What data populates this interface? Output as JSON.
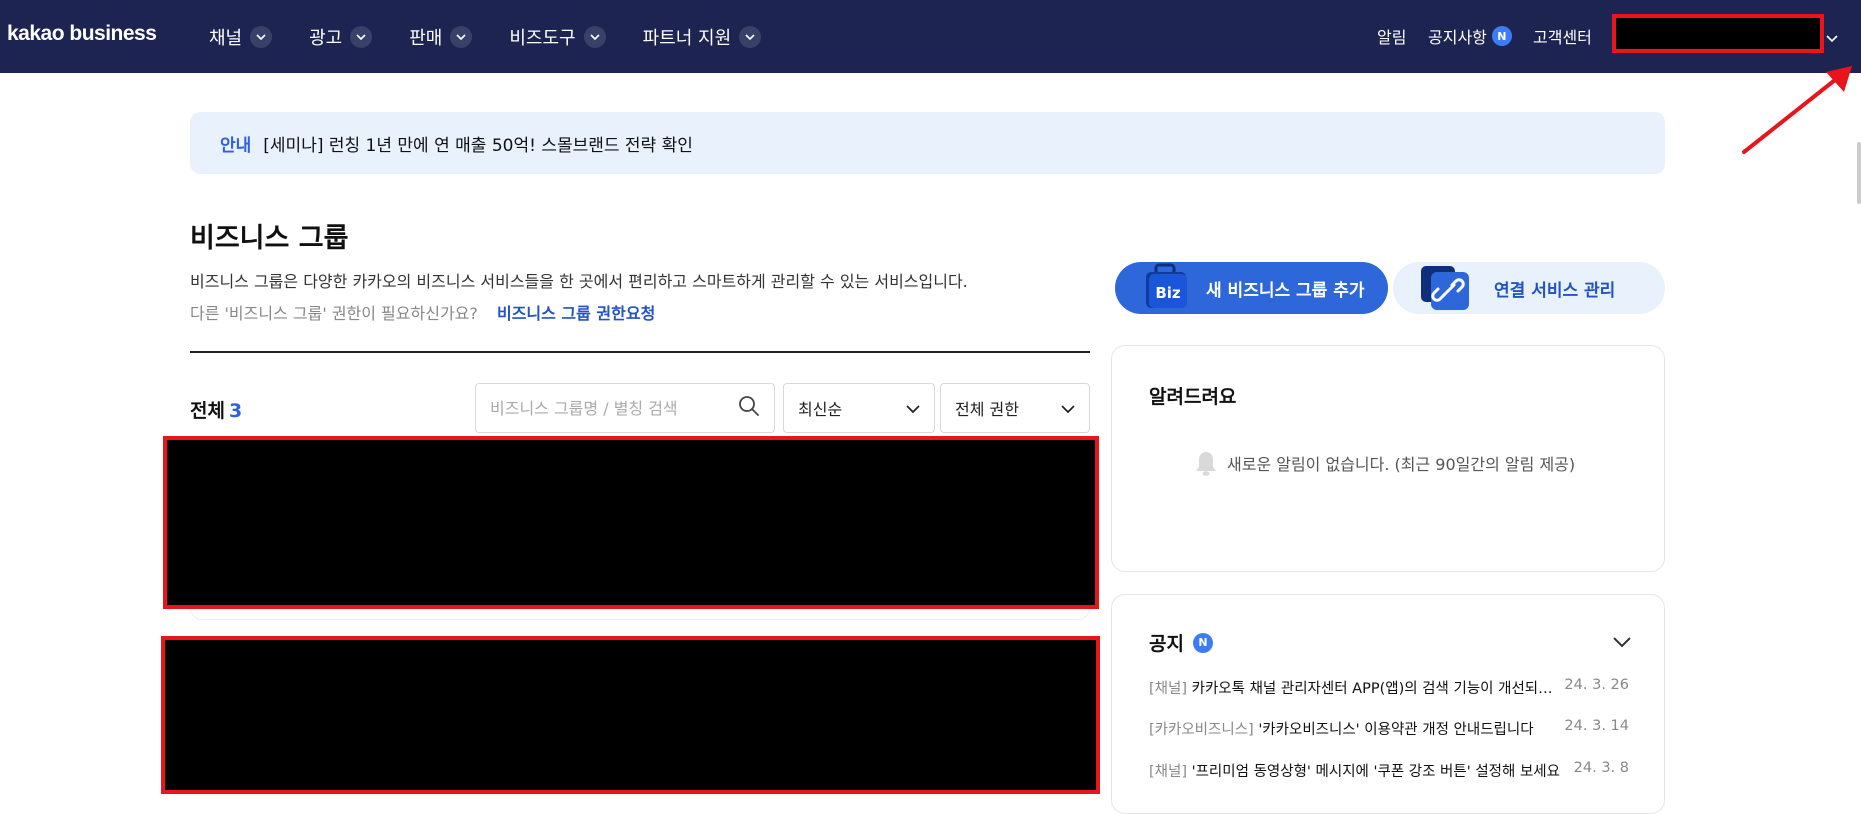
{
  "header": {
    "logo": "kakao business",
    "nav": [
      {
        "label": "채널"
      },
      {
        "label": "광고"
      },
      {
        "label": "판매"
      },
      {
        "label": "비즈도구"
      },
      {
        "label": "파트너 지원"
      }
    ],
    "util": {
      "alarm": "알림",
      "notice": "공지사항",
      "notice_badge": "N",
      "support": "고객센터"
    }
  },
  "banner": {
    "tag": "안내",
    "message": "[세미나] 런칭 1년 만에 연 매출 50억! 스몰브랜드 전략 확인"
  },
  "main": {
    "title": "비즈니스 그룹",
    "description": "비즈니스 그룹은 다양한 카카오의 비즈니스 서비스들을 한 곳에서 편리하고 스마트하게 관리할 수 있는 서비스입니다.",
    "permission_question": "다른 '비즈니스 그룹' 권한이 필요하신가요?",
    "permission_link": "비즈니스 그룹 권한요청",
    "total_label": "전체",
    "total_count": "3",
    "search_placeholder": "비즈니스 그룹명 / 별칭 검색",
    "sort_selected": "최신순",
    "role_selected": "전체 권한"
  },
  "actions": {
    "add_group": "새 비즈니스 그룹 추가",
    "add_group_icon_text": "Biz",
    "manage_services": "연결 서비스 관리"
  },
  "alerts": {
    "title": "알려드려요",
    "empty": "새로운 알림이 없습니다. (최근 90일간의 알림 제공)"
  },
  "notices": {
    "title": "공지",
    "badge": "N",
    "items": [
      {
        "category": "[채널]",
        "text": "카카오톡 채널 관리자센터 APP(앱)의 검색 기능이 개선되었습니다",
        "date": "24. 3. 26"
      },
      {
        "category": "[카카오비즈니스]",
        "text": "'카카오비즈니스' 이용약관 개정 안내드립니다",
        "date": "24. 3. 14"
      },
      {
        "category": "[채널]",
        "text": "'프리미엄 동영상형' 메시지에 '쿠폰 강조 버튼' 설정해 보세요",
        "date": "24. 3. 8"
      }
    ]
  },
  "colors": {
    "header_bg": "#1d2451",
    "accent": "#2d67d9",
    "redaction_border": "#e8151c"
  }
}
